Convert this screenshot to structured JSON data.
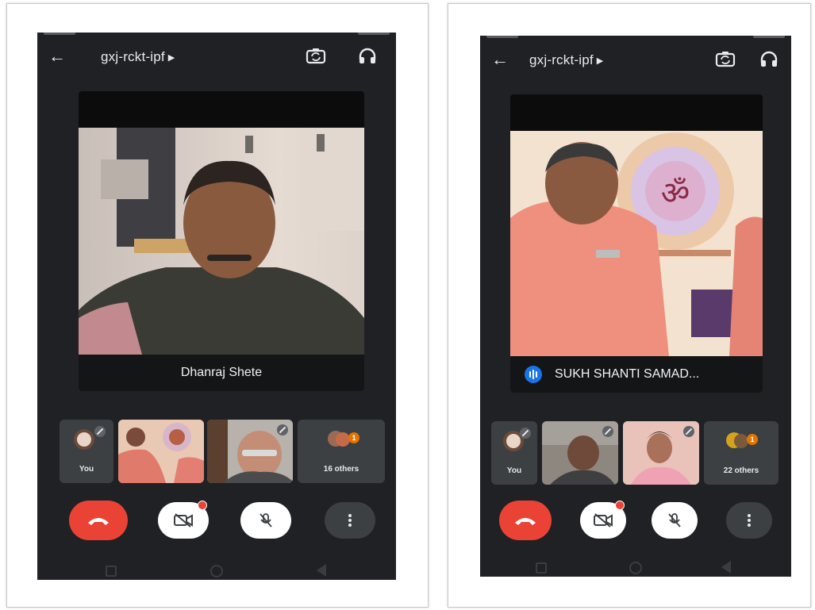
{
  "left_phone": {
    "meeting_code": "gxj-rckt-ipf",
    "main_speaker": "Dhanraj Shete",
    "thumb_you_label": "You",
    "others_label": "16 others",
    "others_badge": "1",
    "video_off_badge": "!"
  },
  "right_phone": {
    "meeting_code": "gxj-rckt-ipf",
    "main_speaker": "SUKH SHANTI SAMAD...",
    "thumb_you_label": "You",
    "others_label": "22 others",
    "others_badge": "1",
    "video_off_badge": "!"
  },
  "icons": {
    "back": "arrow-left-icon",
    "switch_camera": "switch-camera-icon",
    "audio_output": "headset-icon",
    "end_call": "phone-hangup-icon",
    "camera_off": "camera-off-icon",
    "mic_off": "mic-off-icon",
    "more": "more-vert-icon"
  },
  "colors": {
    "app_background": "#202124",
    "end_call": "#ea4335",
    "speaking_indicator": "#1a73e8",
    "others_badge": "#e37400"
  }
}
